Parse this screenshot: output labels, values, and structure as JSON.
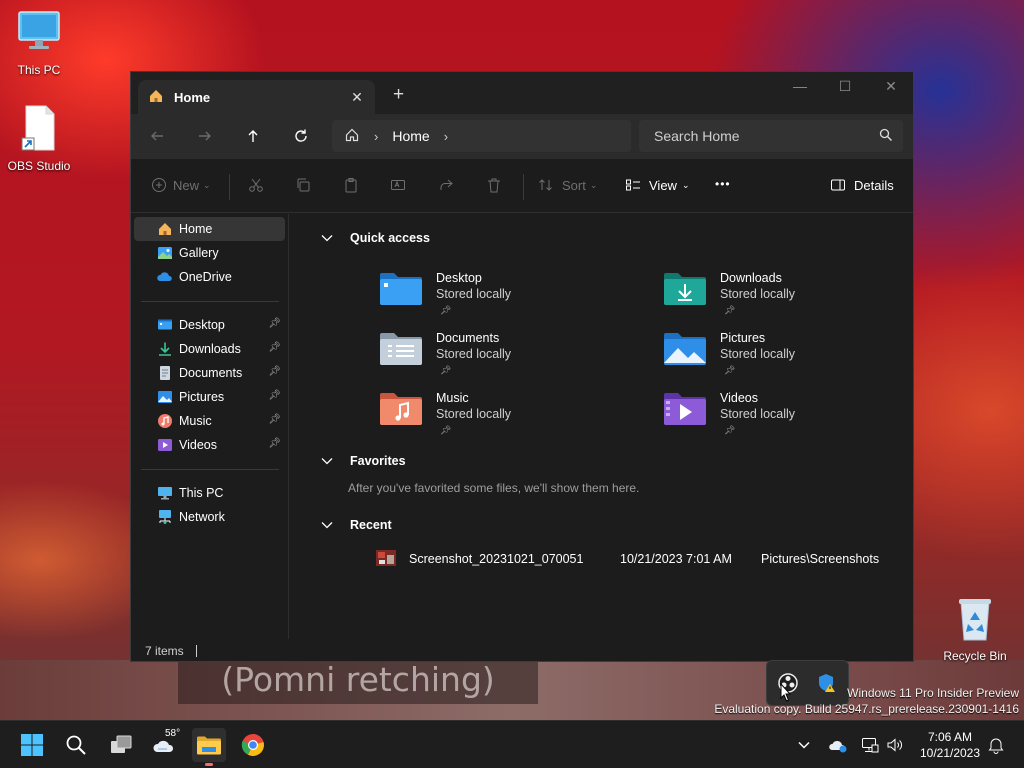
{
  "desktop": {
    "icons": [
      {
        "label": "This PC"
      },
      {
        "label": "OBS Studio"
      },
      {
        "label": "Recycle Bin"
      }
    ],
    "background_caption": "(Pomni retching)"
  },
  "window": {
    "tab_title": "Home",
    "address": {
      "location": "Home"
    },
    "search": {
      "placeholder": "Search Home"
    },
    "toolbar": {
      "new_label": "New",
      "sort_label": "Sort",
      "view_label": "View",
      "more_label": "•••",
      "details_label": "Details"
    },
    "sidebar": {
      "group1": [
        {
          "label": "Home"
        },
        {
          "label": "Gallery"
        },
        {
          "label": "OneDrive"
        }
      ],
      "group2": [
        {
          "label": "Desktop"
        },
        {
          "label": "Downloads"
        },
        {
          "label": "Documents"
        },
        {
          "label": "Pictures"
        },
        {
          "label": "Music"
        },
        {
          "label": "Videos"
        }
      ],
      "group3": [
        {
          "label": "This PC"
        },
        {
          "label": "Network"
        }
      ]
    },
    "quick_access": {
      "title": "Quick access",
      "items": [
        {
          "name": "Desktop",
          "status": "Stored locally"
        },
        {
          "name": "Downloads",
          "status": "Stored locally"
        },
        {
          "name": "Documents",
          "status": "Stored locally"
        },
        {
          "name": "Pictures",
          "status": "Stored locally"
        },
        {
          "name": "Music",
          "status": "Stored locally"
        },
        {
          "name": "Videos",
          "status": "Stored locally"
        }
      ]
    },
    "favorites": {
      "title": "Favorites",
      "empty_message": "After you've favorited some files, we'll show them here."
    },
    "recent": {
      "title": "Recent",
      "items": [
        {
          "name": "Screenshot_20231021_070051",
          "date": "10/21/2023 7:01 AM",
          "location": "Pictures\\Screenshots"
        }
      ]
    },
    "status": {
      "items_count": "7 items"
    }
  },
  "watermark": {
    "line1": "Windows 11 Pro Insider Preview",
    "line2": "Evaluation copy. Build 25947.rs_prerelease.230901-1416"
  },
  "taskbar": {
    "weather_temp": "58°",
    "clock_time": "7:06 AM",
    "clock_date": "10/21/2023"
  },
  "colors": {
    "window_bg": "#1c1c1c",
    "accent_blue": "#3aa0f3",
    "folder_teal": "#1fa89a"
  }
}
